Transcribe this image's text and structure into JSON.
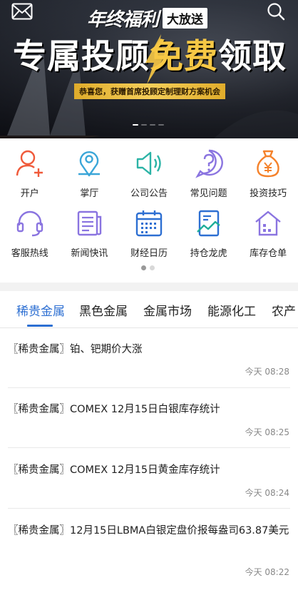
{
  "banner": {
    "promo_script": "年终福利",
    "promo_boxed": "大放送",
    "headline_a": "专属投顾",
    "headline_b": "免费",
    "headline_c": "领取",
    "subtitle": "恭喜您，获赠首席投顾定制理财方案机会",
    "slide_count": 4,
    "active_slide": 1,
    "icons": {
      "left": "mail-icon",
      "right": "search-icon"
    },
    "colors": {
      "gold": "#f7c845",
      "sub_bg": "#f0c04a"
    }
  },
  "grid": {
    "page_count": 2,
    "active_page": 1,
    "rows": [
      [
        {
          "label": "开户",
          "icon": "user-add-icon",
          "color": "#f05a3a"
        },
        {
          "label": "掌厅",
          "icon": "location-pin-icon",
          "color": "#3aa6d8"
        },
        {
          "label": "公司公告",
          "icon": "speaker-icon",
          "color": "#2bb3a6"
        },
        {
          "label": "常见问题",
          "icon": "question-icon",
          "color": "#8a74e0"
        },
        {
          "label": "投资技巧",
          "icon": "money-bag-icon",
          "color": "#f5822b"
        }
      ],
      [
        {
          "label": "客服热线",
          "icon": "headset-icon",
          "color": "#8a74e0"
        },
        {
          "label": "新闻快讯",
          "icon": "newspaper-icon",
          "color": "#8a74e0"
        },
        {
          "label": "财经日历",
          "icon": "calendar-icon",
          "color": "#2d6fd2"
        },
        {
          "label": "持仓龙虎",
          "icon": "chart-doc-icon",
          "color": "#2d6fd2"
        },
        {
          "label": "库存仓单",
          "icon": "warehouse-icon",
          "color": "#8a74e0"
        }
      ]
    ]
  },
  "tabs": {
    "active_color": "#2d6fd2",
    "items": [
      "稀贵金属",
      "黑色金属",
      "金属市场",
      "能源化工",
      "农产"
    ]
  },
  "news": [
    {
      "title": "〖稀贵金属〗铂、钯期价大涨",
      "time": "今天 08:28"
    },
    {
      "title": "〖稀贵金属〗COMEX 12月15日白银库存统计",
      "time": "今天 08:25"
    },
    {
      "title": "〖稀贵金属〗COMEX 12月15日黄金库存统计",
      "time": "今天 08:24"
    },
    {
      "title": "〖稀贵金属〗12月15日LBMA白银定盘价报每盎司63.87美元",
      "time": "今天 08:22"
    }
  ]
}
